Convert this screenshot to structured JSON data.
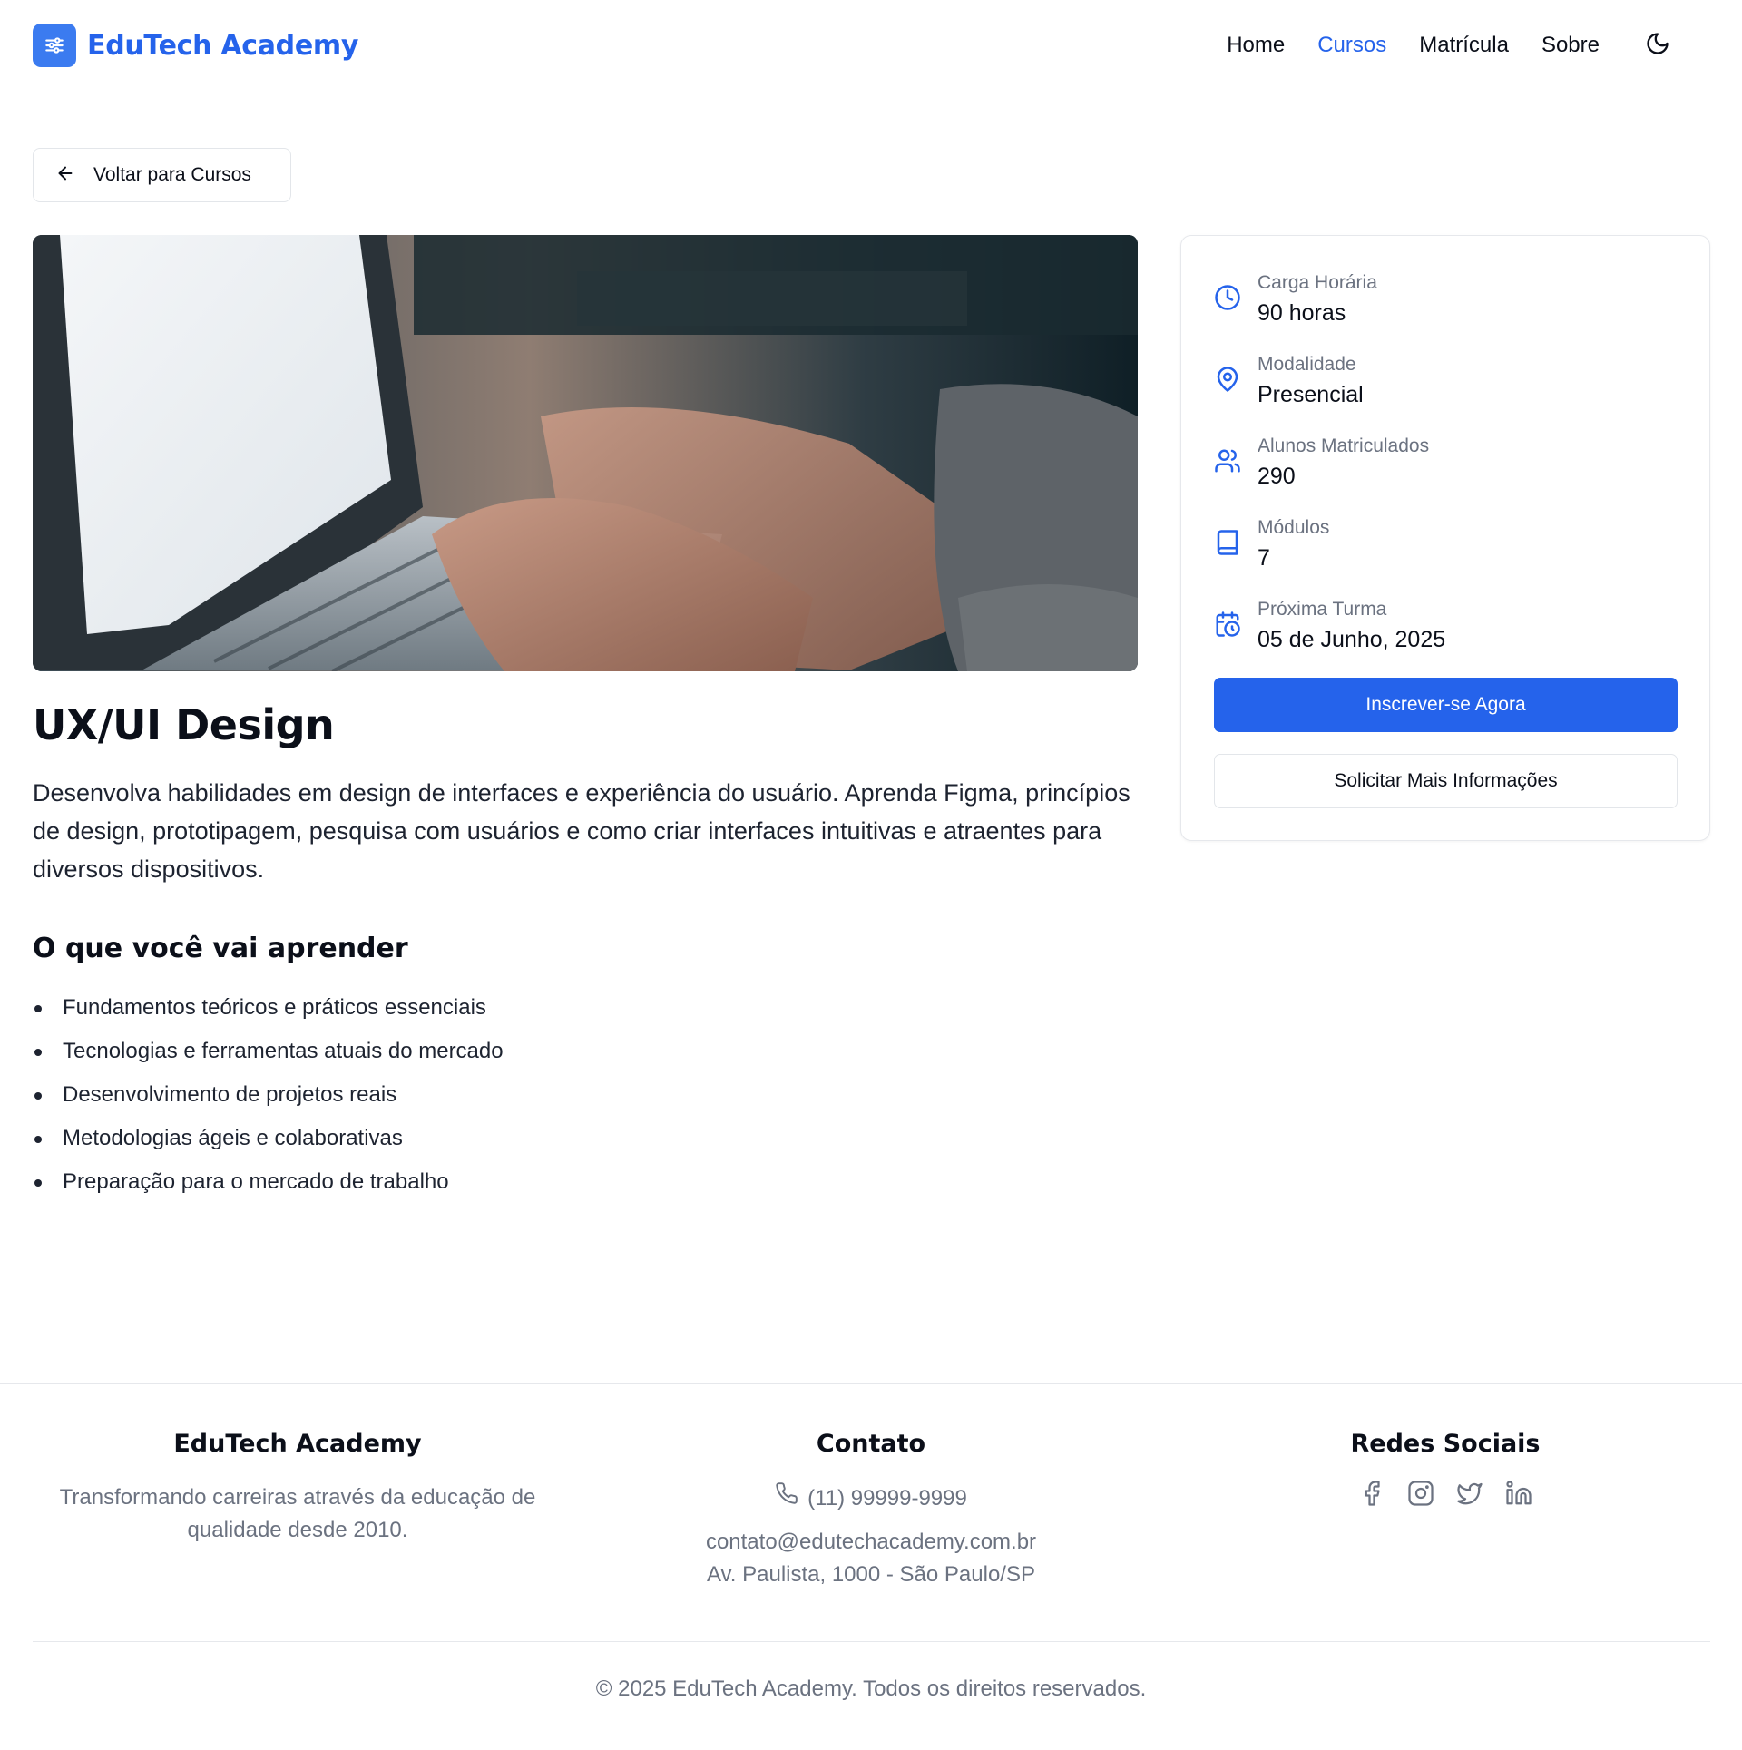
{
  "header": {
    "brand": "EduTech Academy",
    "nav": [
      "Home",
      "Cursos",
      "Matrícula",
      "Sobre"
    ],
    "active_nav": "Cursos"
  },
  "back_button": "Voltar para Cursos",
  "course": {
    "title": "UX/UI Design",
    "description": "Desenvolva habilidades em design de interfaces e experiência do usuário. Aprenda Figma, princípios de design, prototipagem, pesquisa com usuários e como criar interfaces intuitivas e atraentes para diversos dispositivos.",
    "learn_title": "O que você vai aprender",
    "learn_items": [
      "Fundamentos teóricos e práticos essenciais",
      "Tecnologias e ferramentas atuais do mercado",
      "Desenvolvimento de projetos reais",
      "Metodologias ágeis e colaborativas",
      "Preparação para o mercado de trabalho"
    ]
  },
  "info": [
    {
      "label": "Carga Horária",
      "value": "90 horas",
      "icon": "clock-icon"
    },
    {
      "label": "Modalidade",
      "value": "Presencial",
      "icon": "map-pin-icon"
    },
    {
      "label": "Alunos Matriculados",
      "value": "290",
      "icon": "users-icon"
    },
    {
      "label": "Módulos",
      "value": "7",
      "icon": "book-icon"
    },
    {
      "label": "Próxima Turma",
      "value": "05 de Junho, 2025",
      "icon": "calendar-clock-icon"
    }
  ],
  "buttons": {
    "enroll": "Inscrever-se Agora",
    "info": "Solicitar Mais Informações"
  },
  "footer": {
    "about_title": "EduTech Academy",
    "about_text": "Transformando carreiras através da educação de qualidade desde 2010.",
    "contact_title": "Contato",
    "phone": "(11) 99999-9999",
    "email": "contato@edutechacademy.com.br",
    "address": "Av. Paulista, 1000 - São Paulo/SP",
    "social_title": "Redes Sociais",
    "social_icons": [
      "facebook-icon",
      "instagram-icon",
      "twitter-icon",
      "linkedin-icon"
    ],
    "copyright": "© 2025 EduTech Academy. Todos os direitos reservados."
  },
  "colors": {
    "primary": "#2563eb",
    "muted": "#6b7280",
    "text": "#0b0f19"
  }
}
